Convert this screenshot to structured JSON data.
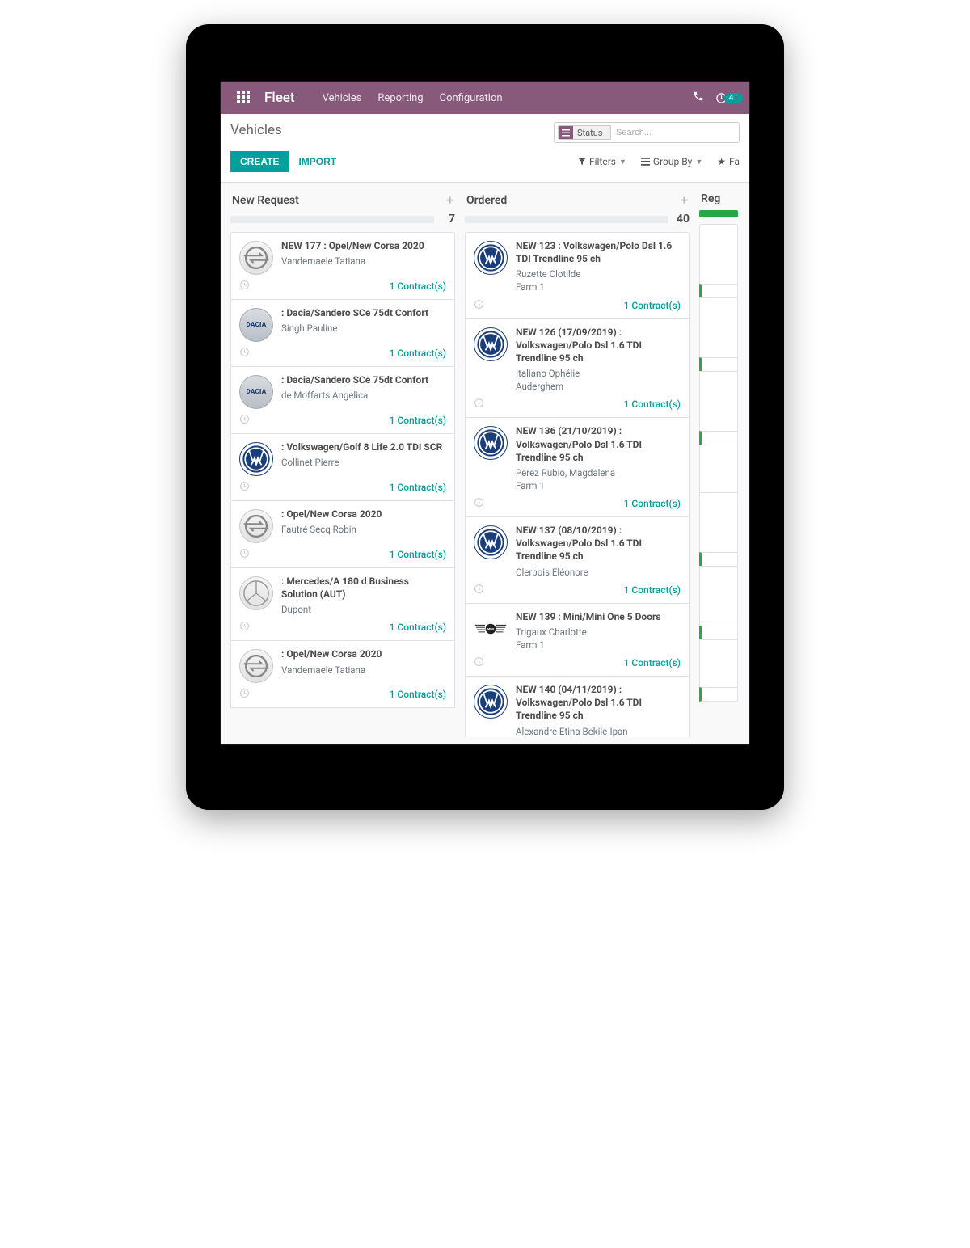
{
  "navbar": {
    "brand": "Fleet",
    "menu": [
      "Vehicles",
      "Reporting",
      "Configuration"
    ],
    "notif_count": "41"
  },
  "breadcrumb": "Vehicles",
  "search": {
    "facet_label": "Status",
    "placeholder": "Search..."
  },
  "buttons": {
    "create": "CREATE",
    "import": "IMPORT"
  },
  "search_options": {
    "filters": "Filters",
    "groupby": "Group By",
    "favorites": "Fa"
  },
  "columns": [
    {
      "title": "New Request",
      "count": "7",
      "cards": [
        {
          "logo": "opel",
          "title": "NEW 177 : Opel/New Corsa 2020",
          "sub1": "Vandemaele Tatiana",
          "sub2": "",
          "contract": "1 Contract(s)"
        },
        {
          "logo": "dacia",
          "title": ": Dacia/Sandero SCe 75dt Confort",
          "sub1": "Singh Pauline",
          "sub2": "",
          "contract": "1 Contract(s)"
        },
        {
          "logo": "dacia",
          "title": ": Dacia/Sandero SCe 75dt Confort",
          "sub1": "de Moffarts Angelica",
          "sub2": "",
          "contract": "1 Contract(s)"
        },
        {
          "logo": "vw",
          "title": ": Volkswagen/Golf 8 Life 2.0 TDI SCR",
          "sub1": "Collinet Pierre",
          "sub2": "",
          "contract": "1 Contract(s)"
        },
        {
          "logo": "opel",
          "title": ": Opel/New Corsa 2020",
          "sub1": "Fautré Secq Robin",
          "sub2": "",
          "contract": "1 Contract(s)"
        },
        {
          "logo": "merc",
          "title": ": Mercedes/A 180 d Business Solution (AUT)",
          "sub1": "Dupont",
          "sub2": "",
          "contract": "1 Contract(s)"
        },
        {
          "logo": "opel",
          "title": ": Opel/New Corsa 2020",
          "sub1": "Vandemaele Tatiana",
          "sub2": "",
          "contract": "1 Contract(s)"
        }
      ]
    },
    {
      "title": "Ordered",
      "count": "40",
      "cards": [
        {
          "logo": "vw",
          "title": "NEW 123 : Volkswagen/Polo Dsl 1.6 TDI Trendline 95 ch",
          "sub1": "Ruzette Clotilde",
          "sub2": "Farm 1",
          "contract": "1 Contract(s)"
        },
        {
          "logo": "vw",
          "title": "NEW 126 (17/09/2019) : Volkswagen/Polo Dsl 1.6 TDI Trendline 95 ch",
          "sub1": "Italiano Ophélie",
          "sub2": "Auderghem",
          "contract": "1 Contract(s)"
        },
        {
          "logo": "vw",
          "title": "NEW 136 (21/10/2019) : Volkswagen/Polo Dsl 1.6 TDI Trendline 95 ch",
          "sub1": "Perez Rubio, Magdalena",
          "sub2": "Farm 1",
          "contract": "1 Contract(s)"
        },
        {
          "logo": "vw",
          "title": "NEW 137 (08/10/2019) : Volkswagen/Polo Dsl 1.6 TDI Trendline 95 ch",
          "sub1": "Clerbois Eléonore",
          "sub2": "",
          "contract": "1 Contract(s)"
        },
        {
          "logo": "mini",
          "title": "NEW 139 : Mini/Mini One 5 Doors",
          "sub1": "Trigaux Charlotte",
          "sub2": "Farm 1",
          "contract": "1 Contract(s)"
        },
        {
          "logo": "vw",
          "title": "NEW 140 (04/11/2019) : Volkswagen/Polo Dsl 1.6 TDI Trendline 95 ch",
          "sub1": "Alexandre Etina Bekile-Ipan",
          "sub2": "",
          "contract": ""
        }
      ]
    },
    {
      "title": "Reg",
      "count": "",
      "cards": []
    }
  ]
}
